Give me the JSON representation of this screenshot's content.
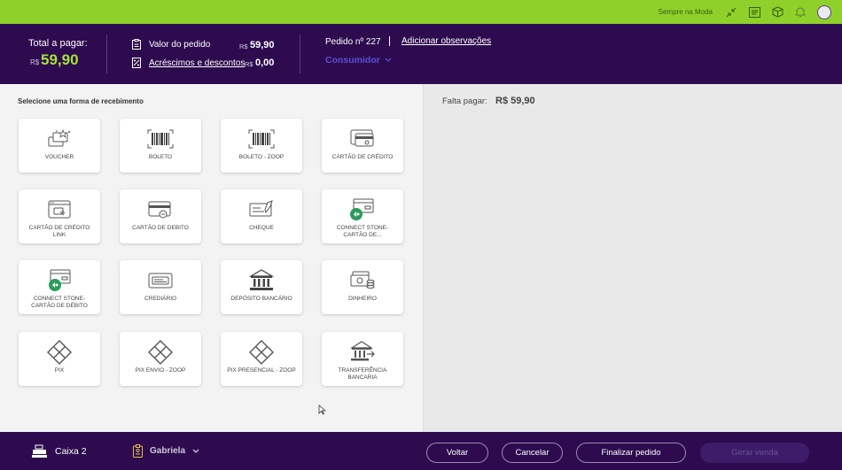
{
  "topbar": {
    "store_name": "Sempre na Moda",
    "icons": [
      "collapse-arrows-icon",
      "receipt-icon",
      "box-icon",
      "bell-icon",
      "avatar-icon"
    ]
  },
  "header": {
    "total_label": "Total a pagar:",
    "total_currency": "R$",
    "total_value": "59,90",
    "valor_label": "Valor do pedido",
    "valor_currency": "R$",
    "valor_amount": "59,90",
    "acrescimos_label": "Acréscimos e descontos",
    "acrescimos_currency": "R$",
    "acrescimos_amount": "0,00",
    "pedido_label": "Pedido nº 227",
    "obs_link": "Adicionar observações",
    "consumidor": "Consumidor"
  },
  "payment": {
    "title": "Selecione uma forma de recebimento",
    "methods": [
      {
        "label": "VOUCHER",
        "icon": "voucher-icon"
      },
      {
        "label": "BOLETO",
        "icon": "barcode-icon"
      },
      {
        "label": "BOLETO - ZOOP",
        "icon": "barcode-icon"
      },
      {
        "label": "CARTÃO DE CRÉDITO",
        "icon": "credit-card-icon"
      },
      {
        "label": "CARTÃO DE CRÉDITO LINK",
        "icon": "card-link-icon"
      },
      {
        "label": "CARTÃO DE DEBITO",
        "icon": "debit-card-icon"
      },
      {
        "label": "CHEQUE",
        "icon": "cheque-icon"
      },
      {
        "label": "CONNECT STONE-CARTÃO DE...",
        "icon": "stone-card-icon"
      },
      {
        "label": "CONNECT STONE-CARTÃO DE DÉBITO",
        "icon": "stone-card-icon"
      },
      {
        "label": "CREDIÁRIO",
        "icon": "crediario-icon"
      },
      {
        "label": "DEPÓSITO BANCÁRIO",
        "icon": "bank-icon"
      },
      {
        "label": "DINHEIRO",
        "icon": "cash-icon"
      },
      {
        "label": "PIX",
        "icon": "pix-icon"
      },
      {
        "label": "PIX ENVIO - ZOOP",
        "icon": "pix-icon"
      },
      {
        "label": "PIX PRESENCIAL - ZOOP",
        "icon": "pix-icon"
      },
      {
        "label": "TRANSFERÊNCIA BANCARIA",
        "icon": "bank-transfer-icon"
      }
    ]
  },
  "summary": {
    "falta_label": "Falta pagar:",
    "falta_value": "R$ 59,90"
  },
  "footer": {
    "caixa": "Caixa 2",
    "operador": "Gabriela",
    "voltar": "Voltar",
    "cancelar": "Cancelar",
    "finalizar": "Finalizar pedido",
    "gerar": "Gerar venda"
  },
  "colors": {
    "accent_green": "#8fd12a",
    "brand_purple": "#2d0b4e",
    "total_green": "#a6e33a",
    "link_blue": "#5b4fd6"
  }
}
